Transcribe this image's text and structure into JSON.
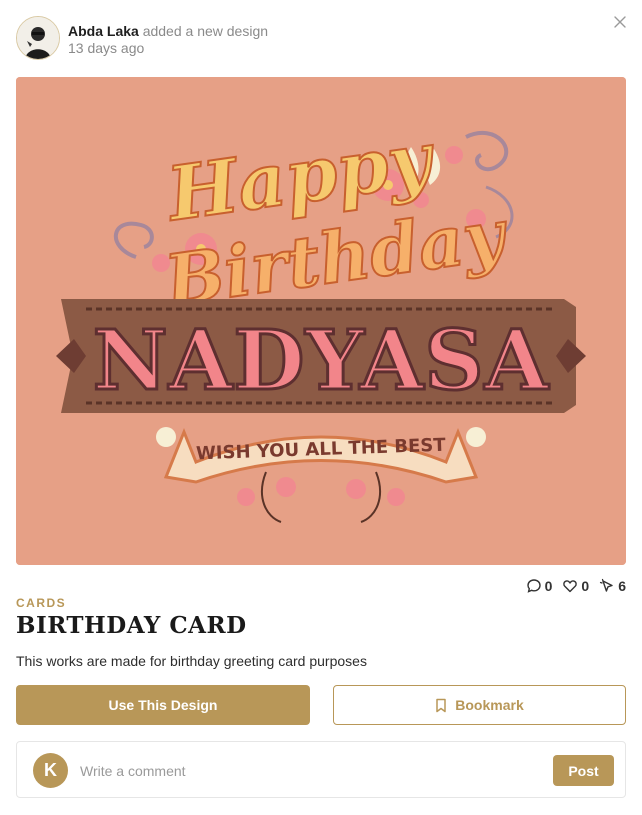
{
  "post": {
    "author_name": "Abda Laka",
    "action_text": "added a new design",
    "timestamp": "13 days ago"
  },
  "design": {
    "category": "CARDS",
    "title": "BIRTHDAY CARD",
    "description": "This works are made for birthday greeting card purposes",
    "artwork": {
      "line1": "Happy",
      "line2": "Birthday",
      "name": "NADYASA",
      "ribbon": "WISH YOU ALL THE BEST"
    }
  },
  "stats": {
    "comments": "0",
    "likes": "0",
    "views": "6"
  },
  "actions": {
    "primary_label": "Use This Design",
    "bookmark_label": "Bookmark"
  },
  "comment": {
    "avatar_letter": "K",
    "placeholder": "Write a comment",
    "post_label": "Post"
  },
  "colors": {
    "accent": "#b89758",
    "card_background": "#e6a086",
    "name_pink": "#f2858a",
    "banner_brown": "#8c5a45",
    "script_yellow": "#f6c96e"
  }
}
